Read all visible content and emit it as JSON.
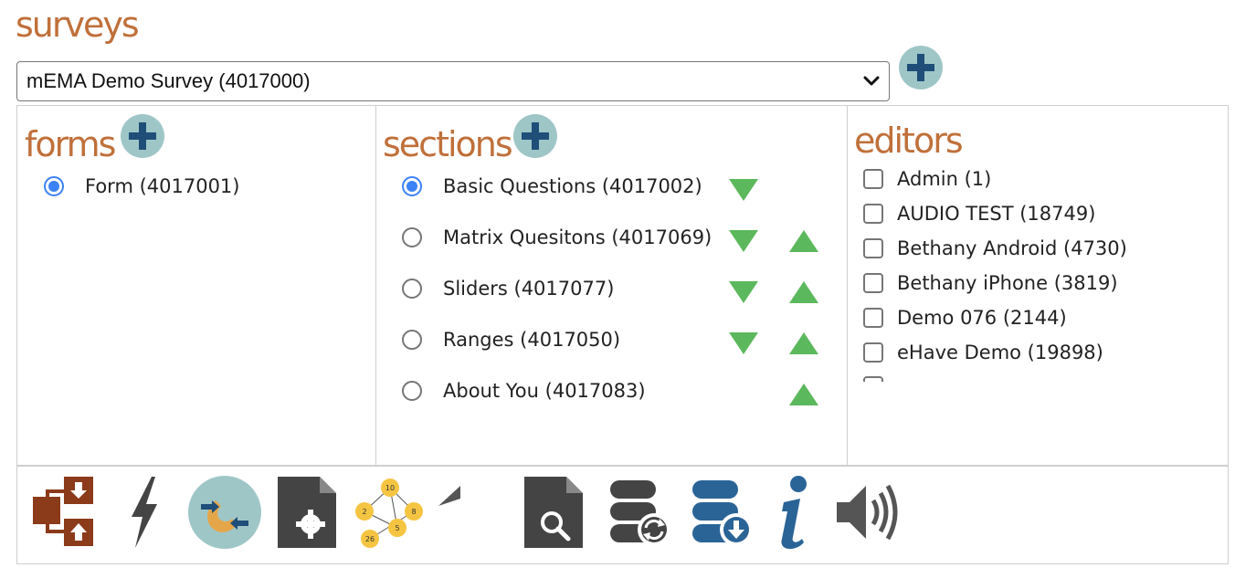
{
  "surveys": {
    "title": "surveys",
    "selected": "mEMA Demo Survey (4017000)"
  },
  "forms": {
    "title": "forms",
    "items": [
      {
        "label": "Form (4017001)",
        "selected": true
      }
    ]
  },
  "sections": {
    "title": "sections",
    "items": [
      {
        "label": "Basic Questions (4017002)",
        "selected": true
      },
      {
        "label": "Matrix Quesitons (4017069)",
        "selected": false
      },
      {
        "label": "Sliders (4017077)",
        "selected": false
      },
      {
        "label": "Ranges (4017050)",
        "selected": false
      },
      {
        "label": "About You (4017083)",
        "selected": false
      }
    ]
  },
  "editors": {
    "title": "editors",
    "items": [
      {
        "label": "Admin (1)",
        "checked": false
      },
      {
        "label": "AUDIO TEST (18749)",
        "checked": false
      },
      {
        "label": "Bethany Android (4730)",
        "checked": false
      },
      {
        "label": "Bethany iPhone (3819)",
        "checked": false
      },
      {
        "label": "Demo 076 (2144)",
        "checked": false
      },
      {
        "label": "eHave Demo (19898)",
        "checked": false
      }
    ]
  },
  "toolbar": {
    "icons": [
      "import-export-icon",
      "lightning-icon",
      "phone-transfer-icon",
      "document-settings-icon",
      "branching-network-icon",
      "undo-icon",
      "document-search-icon",
      "database-sync-icon",
      "database-download-icon",
      "info-icon",
      "speaker-icon"
    ],
    "network_numbers": [
      "10",
      "2",
      "8",
      "5",
      "26"
    ]
  },
  "colors": {
    "heading": "#c0703a",
    "add_button_bg": "#9fc6c7",
    "add_button_plus": "#1f4e79",
    "arrow_green": "#5cb85c",
    "radio_blue": "#3b82f6"
  }
}
